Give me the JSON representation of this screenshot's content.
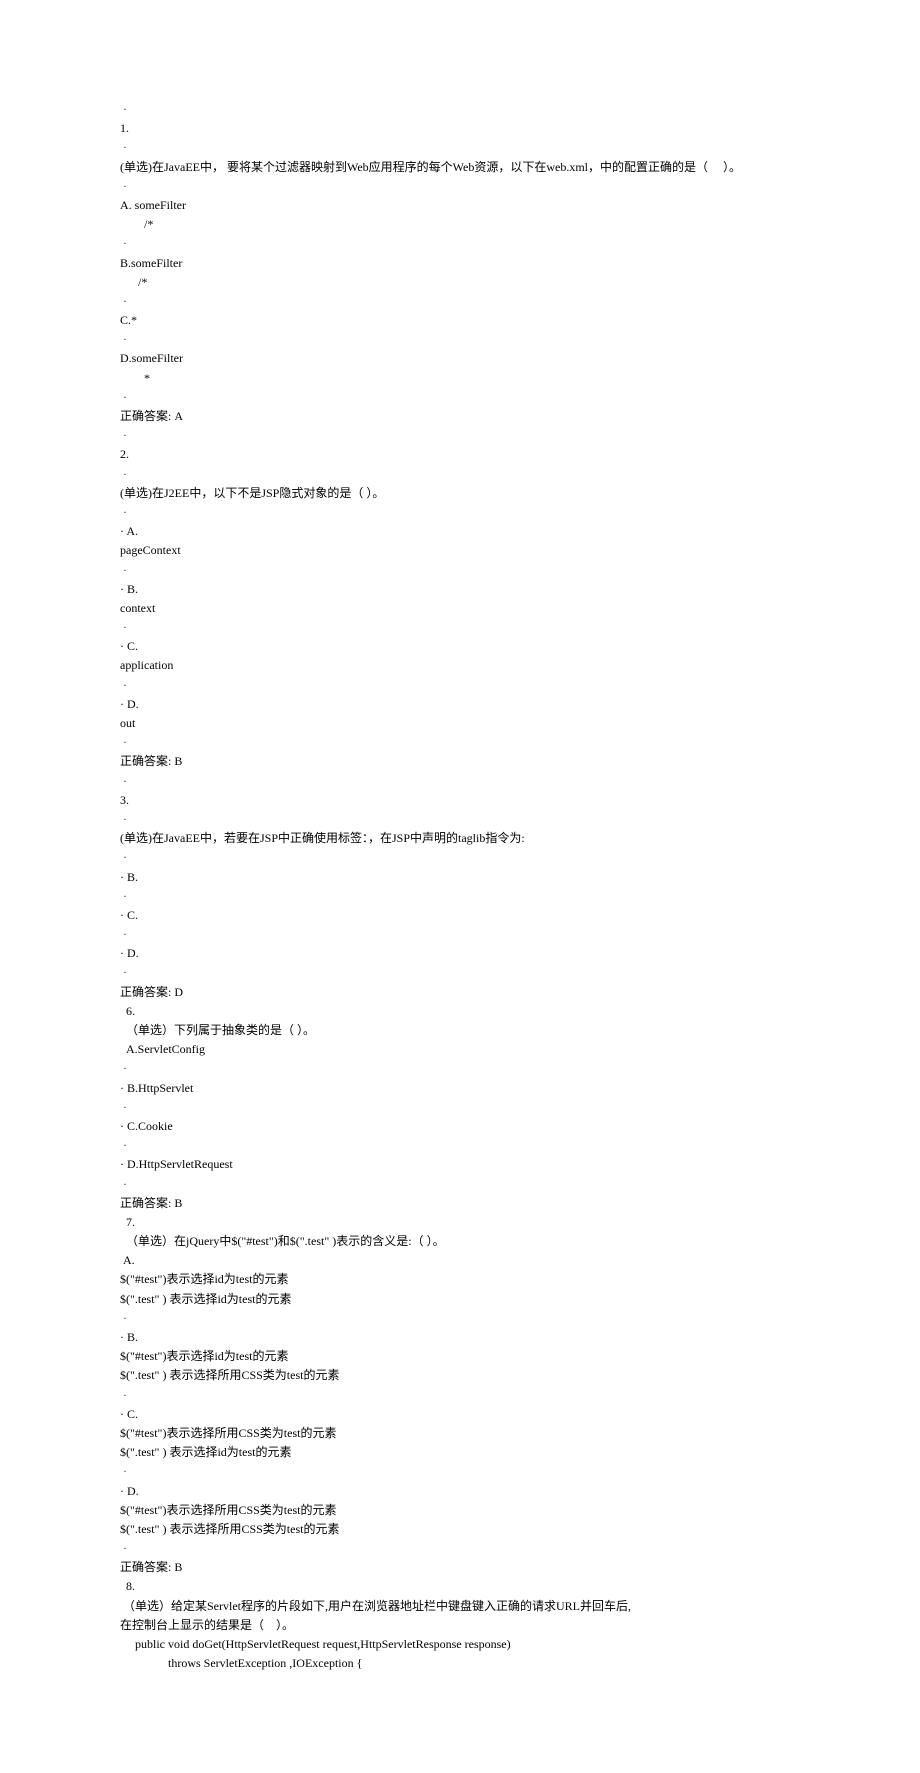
{
  "q1": {
    "num": "1.",
    "text": "(单选)在JavaEE中， 要将某个过滤器映射到Web应用程序的每个Web资源，以下在web.xml，中的配置正确的是（     ）。",
    "A1": "A. someFilter",
    "A2": "        /*",
    "B1": "B.someFilter",
    "B2": "      /*",
    "C": "C.*",
    "D1": "D.someFilter",
    "D2": "        *",
    "ans": "正确答案: A"
  },
  "q2": {
    "num": "2.",
    "text": "(单选)在J2EE中，以下不是JSP隐式对象的是（ ）。",
    "A_lbl": "· A.",
    "A": "pageContext",
    "B_lbl": "· B.",
    "B": "context",
    "C_lbl": "· C.",
    "C": "application",
    "D_lbl": "· D.",
    "D": "out",
    "ans": "正确答案: B"
  },
  "q3": {
    "num": "3.",
    "text": "(单选)在JavaEE中，若要在JSP中正确使用标签：，在JSP中声明的taglib指令为:",
    "B": "· B.",
    "C": "· C.",
    "D": "· D.",
    "ans": "正确答案: D"
  },
  "q6": {
    "num": "  6.",
    "text": "  （单选）下列属于抽象类的是（ ）。",
    "A": "  A.ServletConfig",
    "B": "· B.HttpServlet",
    "C": "· C.Cookie",
    "D": "· D.HttpServletRequest",
    "ans": "正确答案: B"
  },
  "q7": {
    "num": "  7.",
    "text": "  （单选）在jQuery中$(\"#test\")和$(\".test\" )表示的含义是:（ ）。",
    "A_lbl": " A.",
    "A1": "$(\"#test\")表示选择id为test的元素",
    "A2": "$(\".test\" ) 表示选择id为test的元素",
    "B_lbl": "· B.",
    "B1": "$(\"#test\")表示选择id为test的元素",
    "B2": "$(\".test\" ) 表示选择所用CSS类为test的元素",
    "C_lbl": "· C.",
    "C1": "$(\"#test\")表示选择所用CSS类为test的元素",
    "C2": "$(\".test\" ) 表示选择id为test的元素",
    "D_lbl": "· D.",
    "D1": "$(\"#test\")表示选择所用CSS类为test的元素",
    "D2": "$(\".test\" ) 表示选择所用CSS类为test的元素",
    "ans": "正确答案: B"
  },
  "q8": {
    "num": "  8.",
    "text1": " （单选）给定某Servlet程序的片段如下,用户在浏览器地址栏中键盘键入正确的请求URL并回车后,",
    "text2": "在控制台上显示的结果是（    ）。",
    "code1": "     public void doGet(HttpServletRequest request,HttpServletResponse response)",
    "code2": "                throws ServletException ,IOException {"
  },
  "dot": " ·"
}
